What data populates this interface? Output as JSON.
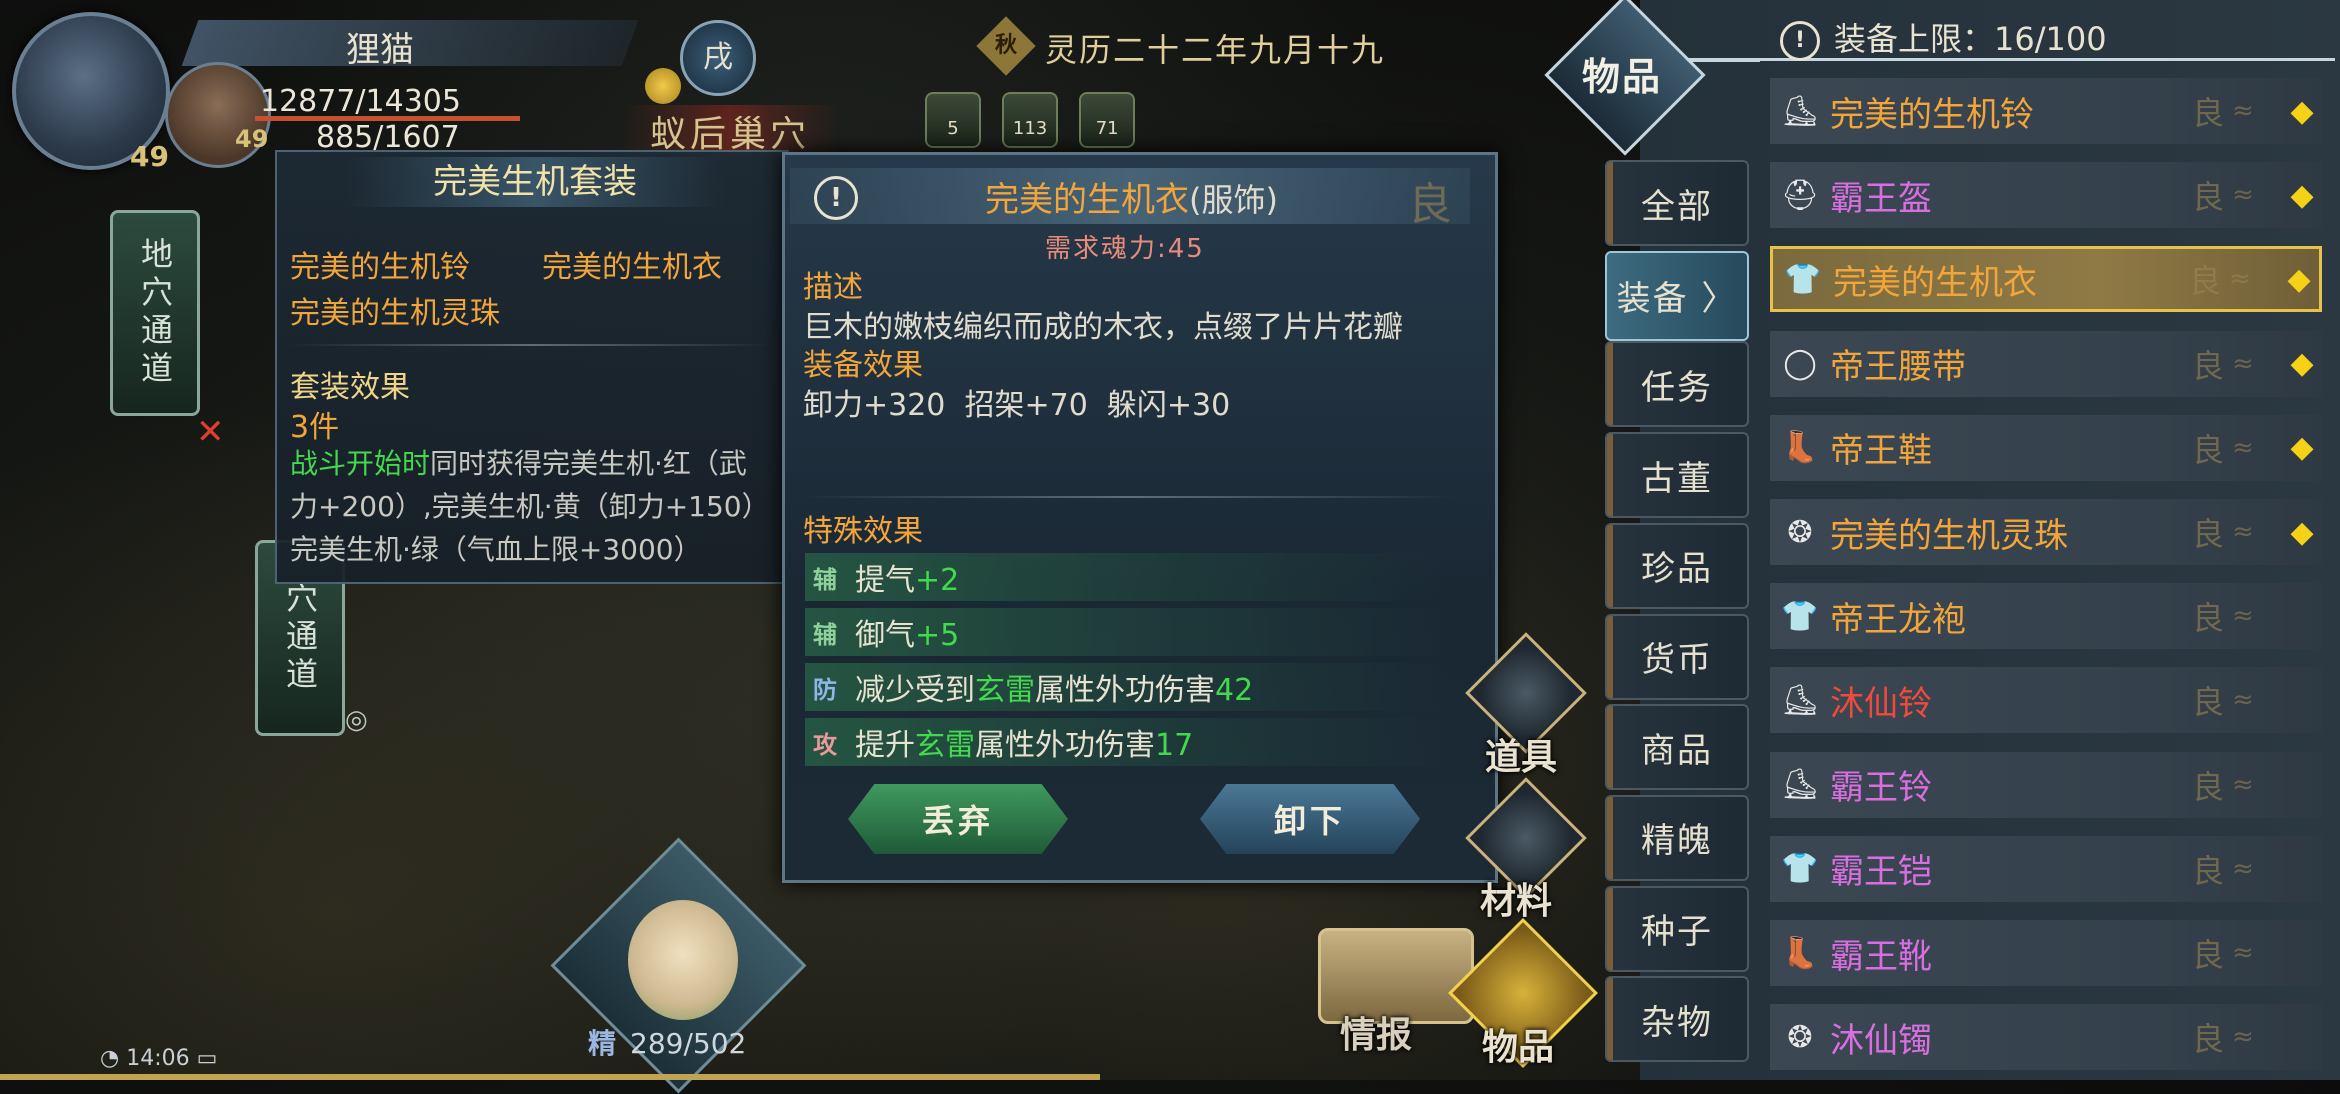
{
  "player": {
    "name": "狸猫",
    "level_main": "49",
    "level_companion": "49",
    "hp": "12877/14305",
    "mp": "885/1607",
    "stance_badge": "戌"
  },
  "location": "蚁后巢穴",
  "calendar": {
    "season": "秋",
    "date": "灵历二十二年九月十九"
  },
  "buffs": [
    {
      "label": "5"
    },
    {
      "label": "113"
    },
    {
      "label": "71"
    }
  ],
  "map": {
    "node_top": "地穴通道",
    "node_bottom": "穴通道"
  },
  "set_panel": {
    "title": "完美生机套装",
    "pieces": [
      "完美的生机铃",
      "完美的生机衣",
      "完美的生机灵珠"
    ],
    "effect_heading": "套装效果",
    "count": "3件",
    "trigger": "战斗开始时",
    "line1_rest": "同时获得完美生机·红（武",
    "line2": "力+200）,完美生机·黄（卸力+150）",
    "line3": "完美生机·绿（气血上限+3000）"
  },
  "item": {
    "name": "完美的生机衣",
    "type": "(服饰)",
    "grade": "良",
    "requirement": "需求魂力:45",
    "desc_heading": "描述",
    "description": "巨木的嫩枝编织而成的木衣，点缀了片片花瓣",
    "equip_heading": "装备效果",
    "equip_effects": "卸力+320  招架+70  躲闪+30",
    "special_heading": "特殊效果",
    "specials": [
      {
        "tag": "辅",
        "tag_color": "#8fd19a",
        "parts": [
          {
            "t": "提气",
            "c": "#e8e2d0"
          },
          {
            "t": "+2",
            "c": "#43d84e"
          }
        ]
      },
      {
        "tag": "辅",
        "tag_color": "#8fd19a",
        "parts": [
          {
            "t": "御气",
            "c": "#e8e2d0"
          },
          {
            "t": "+5",
            "c": "#43d84e"
          }
        ]
      },
      {
        "tag": "防",
        "tag_color": "#8db7e8",
        "parts": [
          {
            "t": "减少受到",
            "c": "#e8e2d0"
          },
          {
            "t": "玄雷",
            "c": "#43d84e"
          },
          {
            "t": "属性外功伤害",
            "c": "#e8e2d0"
          },
          {
            "t": "42",
            "c": "#43d84e"
          }
        ]
      },
      {
        "tag": "攻",
        "tag_color": "#e89a9a",
        "parts": [
          {
            "t": "提升",
            "c": "#e8e2d0"
          },
          {
            "t": "玄雷",
            "c": "#43d84e"
          },
          {
            "t": "属性外功伤害",
            "c": "#e8e2d0"
          },
          {
            "t": "17",
            "c": "#43d84e"
          }
        ]
      }
    ],
    "discard_label": "丢弃",
    "unequip_label": "卸下"
  },
  "companion": {
    "energy_label": "精",
    "energy": "289/502"
  },
  "system": {
    "time": "14:06"
  },
  "bottom_menu": {
    "daoju": "道具",
    "cailiao": "材料",
    "qingbao": "情报",
    "wupin": "物品"
  },
  "inventory": {
    "header": "物品",
    "limit_text": "装备上限：16/100",
    "categories": [
      "全部",
      "装备",
      "任务",
      "古董",
      "珍品",
      "货币",
      "商品",
      "精魄",
      "种子",
      "杂物"
    ],
    "active_category": "装备",
    "items": [
      {
        "name": "完美的生机铃",
        "color": "#f2a53a",
        "icon": "bell",
        "equipped": true,
        "selected": false
      },
      {
        "name": "霸王盔",
        "color": "#d86ee0",
        "icon": "helmet",
        "equipped": true,
        "selected": false
      },
      {
        "name": "完美的生机衣",
        "color": "#f2a53a",
        "icon": "robe",
        "equipped": true,
        "selected": true
      },
      {
        "name": "帝王腰带",
        "color": "#f2a53a",
        "icon": "belt",
        "equipped": true,
        "selected": false
      },
      {
        "name": "帝王鞋",
        "color": "#f2a53a",
        "icon": "boots",
        "equipped": true,
        "selected": false
      },
      {
        "name": "完美的生机灵珠",
        "color": "#f2a53a",
        "icon": "orb",
        "equipped": true,
        "selected": false
      },
      {
        "name": "帝王龙袍",
        "color": "#f2a53a",
        "icon": "robe",
        "equipped": false,
        "selected": false
      },
      {
        "name": "沐仙铃",
        "color": "#f04a3a",
        "icon": "bell",
        "equipped": false,
        "selected": false
      },
      {
        "name": "霸王铃",
        "color": "#d86ee0",
        "icon": "bell",
        "equipped": false,
        "selected": false
      },
      {
        "name": "霸王铠",
        "color": "#d86ee0",
        "icon": "robe",
        "equipped": false,
        "selected": false
      },
      {
        "name": "霸王靴",
        "color": "#d86ee0",
        "icon": "boots",
        "equipped": false,
        "selected": false
      },
      {
        "name": "沐仙镯",
        "color": "#d86ee0",
        "icon": "orb",
        "equipped": false,
        "selected": false
      }
    ],
    "grade_mark": "良"
  }
}
